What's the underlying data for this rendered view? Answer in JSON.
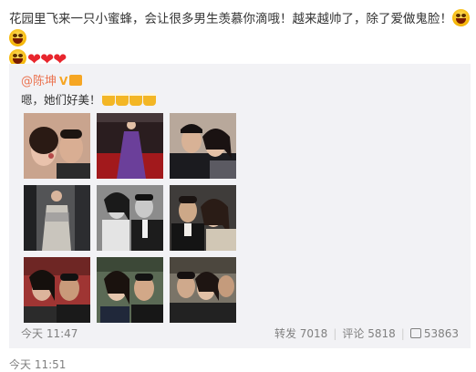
{
  "post": {
    "text_line1": "花园里飞来一只小蜜蜂，会让很多男生羡慕你滴哦！越来越帅了，除了爱做鬼脸！",
    "time": "今天 11:51"
  },
  "repost": {
    "author": "@陈坤",
    "verified": "V",
    "text": "嗯，她们好美！",
    "time": "今天 11:47",
    "reposts_label": "转发",
    "reposts": "7018",
    "comments_label": "评论",
    "comments": "5818",
    "likes": "53863"
  },
  "icons": [
    "laughing-face-icon",
    "heart-icon",
    "beer-icon",
    "thumbs-up-icon",
    "verified-badge-icon"
  ],
  "colors": {
    "author": "#eb7350",
    "heart": "#e8262d",
    "repost_bg": "#f2f2f5"
  }
}
